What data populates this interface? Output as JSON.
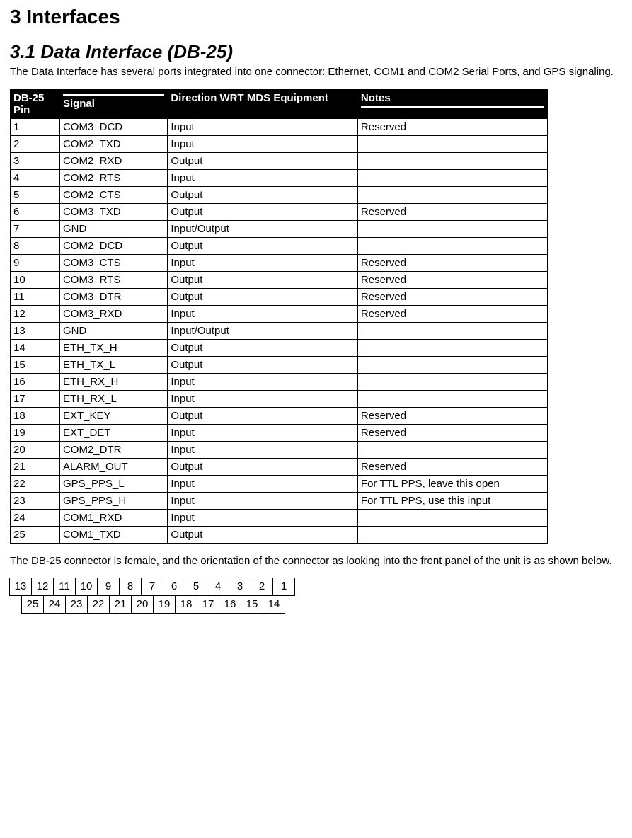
{
  "section_heading": "3   Interfaces",
  "subsection_heading": "3.1  Data Interface (DB-25)",
  "intro_paragraph": "The Data Interface has several ports integrated into one connector:  Ethernet, COM1 and COM2 Serial Ports, and GPS signaling.",
  "table_headers": {
    "pin": "DB-25 Pin",
    "signal": "Signal",
    "direction": "Direction WRT MDS Equipment",
    "notes": "Notes"
  },
  "rows": [
    {
      "pin": "1",
      "signal": "COM3_DCD",
      "dir": "Input",
      "notes": "Reserved"
    },
    {
      "pin": "2",
      "signal": "COM2_TXD",
      "dir": "Input",
      "notes": ""
    },
    {
      "pin": "3",
      "signal": "COM2_RXD",
      "dir": "Output",
      "notes": ""
    },
    {
      "pin": "4",
      "signal": "COM2_RTS",
      "dir": "Input",
      "notes": ""
    },
    {
      "pin": "5",
      "signal": "COM2_CTS",
      "dir": "Output",
      "notes": ""
    },
    {
      "pin": "6",
      "signal": "COM3_TXD",
      "dir": "Output",
      "notes": "Reserved"
    },
    {
      "pin": "7",
      "signal": "GND",
      "dir": "Input/Output",
      "notes": ""
    },
    {
      "pin": "8",
      "signal": "COM2_DCD",
      "dir": "Output",
      "notes": ""
    },
    {
      "pin": "9",
      "signal": "COM3_CTS",
      "dir": "Input",
      "notes": "Reserved"
    },
    {
      "pin": "10",
      "signal": "COM3_RTS",
      "dir": "Output",
      "notes": "Reserved"
    },
    {
      "pin": "11",
      "signal": "COM3_DTR",
      "dir": "Output",
      "notes": "Reserved"
    },
    {
      "pin": "12",
      "signal": "COM3_RXD",
      "dir": "Input",
      "notes": "Reserved"
    },
    {
      "pin": "13",
      "signal": "GND",
      "dir": "Input/Output",
      "notes": ""
    },
    {
      "pin": "14",
      "signal": "ETH_TX_H",
      "dir": "Output",
      "notes": ""
    },
    {
      "pin": "15",
      "signal": "ETH_TX_L",
      "dir": "Output",
      "notes": ""
    },
    {
      "pin": "16",
      "signal": "ETH_RX_H",
      "dir": "Input",
      "notes": ""
    },
    {
      "pin": "17",
      "signal": "ETH_RX_L",
      "dir": "Input",
      "notes": ""
    },
    {
      "pin": "18",
      "signal": "EXT_KEY",
      "dir": "Output",
      "notes": "Reserved"
    },
    {
      "pin": "19",
      "signal": "EXT_DET",
      "dir": "Input",
      "notes": "Reserved"
    },
    {
      "pin": "20",
      "signal": "COM2_DTR",
      "dir": "Input",
      "notes": ""
    },
    {
      "pin": "21",
      "signal": "ALARM_OUT",
      "dir": "Output",
      "notes": "Reserved"
    },
    {
      "pin": "22",
      "signal": "GPS_PPS_L",
      "dir": "Input",
      "notes": "For TTL PPS, leave this open"
    },
    {
      "pin": "23",
      "signal": "GPS_PPS_H",
      "dir": "Input",
      "notes": "For TTL PPS, use this input"
    },
    {
      "pin": "24",
      "signal": "COM1_RXD",
      "dir": "Input",
      "notes": ""
    },
    {
      "pin": "25",
      "signal": "COM1_TXD",
      "dir": "Output",
      "notes": ""
    }
  ],
  "post_paragraph": "The DB-25 connector is female, and the orientation of the connector as looking into the front panel of the unit is as shown below.",
  "connector_top": [
    "13",
    "12",
    "11",
    "10",
    "9",
    "8",
    "7",
    "6",
    "5",
    "4",
    "3",
    "2",
    "1"
  ],
  "connector_bottom": [
    "25",
    "24",
    "23",
    "22",
    "21",
    "20",
    "19",
    "18",
    "17",
    "16",
    "15",
    "14"
  ]
}
